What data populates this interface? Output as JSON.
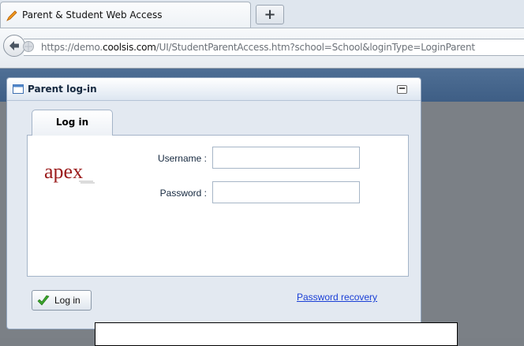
{
  "browser": {
    "tab_title": "Parent & Student Web Access",
    "newtab_label": "+",
    "url_prefix": "https://demo.",
    "url_domain": "coolsis.com",
    "url_path": "/UI/StudentParentAccess.htm?school=School&loginType=LoginParent"
  },
  "dialog": {
    "title": "Parent log-in",
    "tab_label": "Log in",
    "logo_text": "apex",
    "username_label": "Username :",
    "password_label": "Password :",
    "username_value": "",
    "password_value": "",
    "login_button": "Log in",
    "recovery_link": "Password recovery"
  },
  "colors": {
    "accent": "#1a3fd6",
    "header_band": "#4f6f95"
  }
}
